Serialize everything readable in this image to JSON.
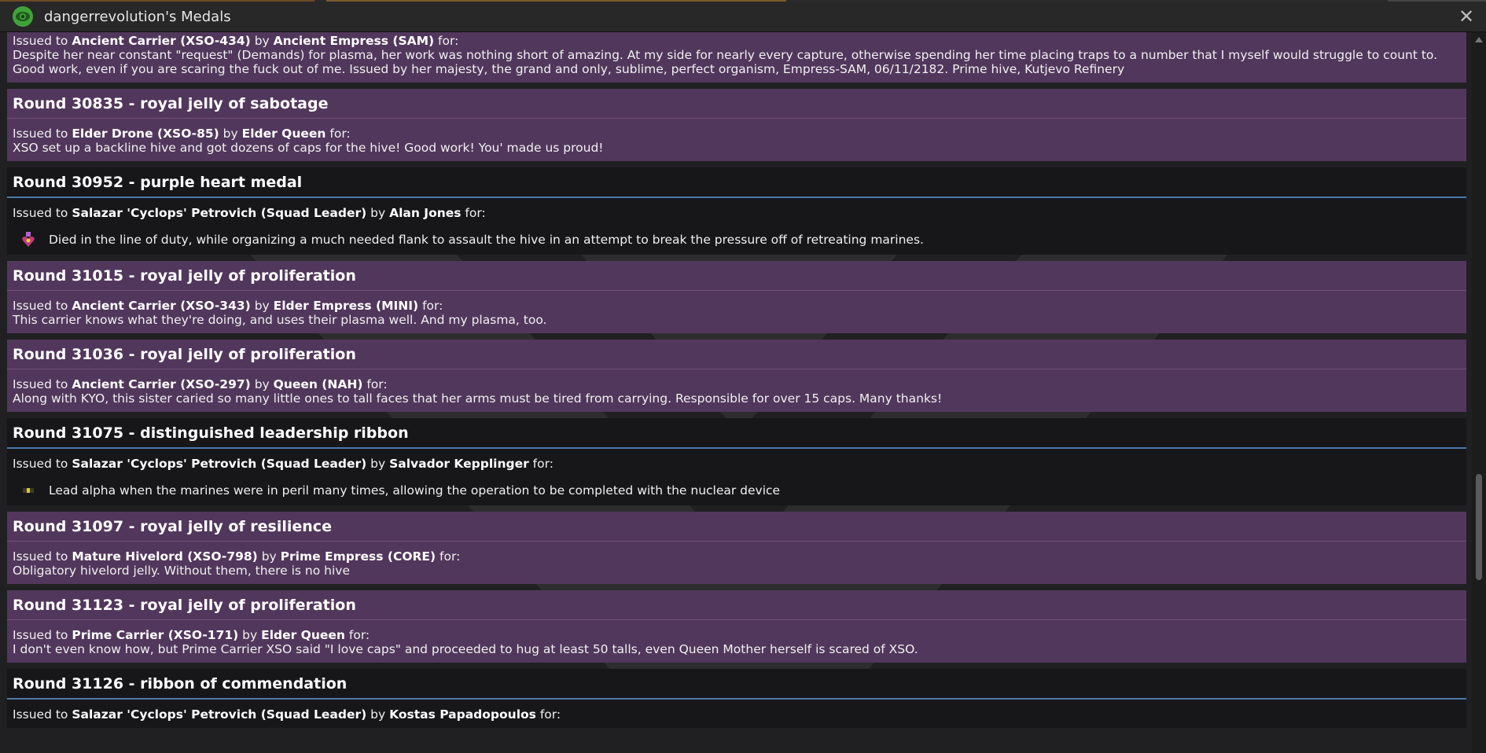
{
  "window": {
    "title": "dangerrevolution's Medals",
    "close_glyph": "✕"
  },
  "first_entry": {
    "issued_prefix": "Issued to ",
    "recipient": "Ancient Carrier (XSO-434)",
    "by_word": " by ",
    "issuer": "Ancient Empress (SAM)",
    "for_word": " for:",
    "message": "Despite her near constant \"request\" (Demands) for plasma, her work was nothing short of amazing. At my side for nearly every capture, otherwise spending her time placing traps to a number that I myself would struggle to count to. Good work, even if you are scaring the fuck out of me. Issued by her majesty, the grand and only, sublime, perfect organism, Empress-SAM, 06/11/2182. Prime hive, Kutjevo Refinery"
  },
  "medals": [
    {
      "kind": "xeno",
      "heading": "Round 30835 - royal jelly of sabotage",
      "recipient": "Elder Drone (XSO-85)",
      "issuer": "Elder Queen",
      "message": "XSO set up a backline hive and got dozens of caps for the hive! Good work! You' made us proud!"
    },
    {
      "kind": "marine",
      "heading": "Round 30952 - purple heart medal",
      "recipient": "Salazar 'Cyclops' Petrovich (Squad Leader)",
      "issuer": "Alan Jones",
      "message": "Died in the line of duty, while organizing a much needed flank to assault the hive in an attempt to break the pressure off of retreating marines.",
      "icon": "purple-heart-medal-icon"
    },
    {
      "kind": "xeno",
      "heading": "Round 31015 - royal jelly of proliferation",
      "recipient": "Ancient Carrier (XSO-343)",
      "issuer": "Elder Empress (MINI)",
      "message": "This carrier knows what they're doing, and uses their plasma well. And my plasma, too."
    },
    {
      "kind": "xeno",
      "heading": "Round 31036 - royal jelly of proliferation",
      "recipient": "Ancient Carrier (XSO-297)",
      "issuer": "Queen (NAH)",
      "message": "Along with KYO, this sister caried so many little ones to tall faces that her arms must be tired from carrying. Responsible for over 15 caps. Many thanks!"
    },
    {
      "kind": "marine",
      "heading": "Round 31075 - distinguished leadership ribbon",
      "recipient": "Salazar 'Cyclops' Petrovich (Squad Leader)",
      "issuer": "Salvador Kepplinger",
      "message": "Lead alpha when the marines were in peril many times, allowing the operation to be completed with the nuclear device",
      "icon": "leadership-ribbon-icon"
    },
    {
      "kind": "xeno",
      "heading": "Round 31097 - royal jelly of resilience",
      "recipient": "Mature Hivelord (XSO-798)",
      "issuer": "Prime Empress (CORE)",
      "message": "Obligatory hivelord jelly. Without them, there is no hive"
    },
    {
      "kind": "xeno",
      "heading": "Round 31123 - royal jelly of proliferation",
      "recipient": "Prime Carrier (XSO-171)",
      "issuer": "Elder Queen",
      "message": "I don't even know how, but Prime Carrier XSO said \"I love caps\" and proceeded to hug at least 50 talls, even Queen Mother herself is scared of XSO."
    },
    {
      "kind": "marine",
      "heading": "Round 31126 - ribbon of commendation",
      "recipient": "Salazar 'Cyclops' Petrovich (Squad Leader)",
      "issuer": "Kostas Papadopoulos",
      "message": ""
    }
  ],
  "labels": {
    "issued_to": "Issued to ",
    "by": " by ",
    "for": " for:"
  },
  "colors": {
    "xeno_card": "#52375c",
    "marine_card": "#17171a",
    "marine_divider": "#4b79a8",
    "titlebar": "#282829",
    "eye_icon": "#3fa33a"
  }
}
